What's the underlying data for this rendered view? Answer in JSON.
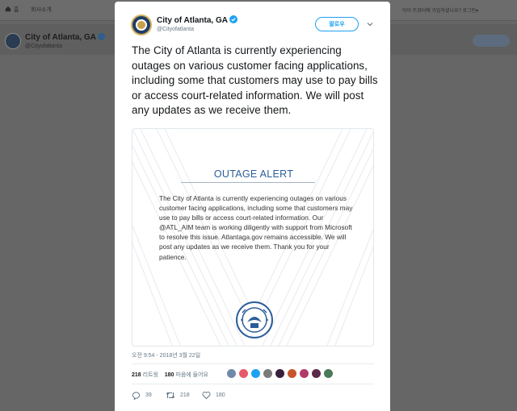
{
  "background": {
    "nav_home": "홈",
    "nav_about": "회사소개",
    "login_prompt": "아이 트위터에 가입하셨나요? 로그인▾",
    "profile_name": "City of Atlanta, GA",
    "profile_handle": "@Cityofatlanta"
  },
  "tweet": {
    "author_name": "City of Atlanta, GA",
    "author_handle": "@Cityofatlanta",
    "follow_label": "팔로우",
    "text": "The City of Atlanta is currently experiencing outages on various customer facing applications, including some that customers may use to pay bills or access court-related information. We will post any updates as we receive them.",
    "timestamp": "오전 9:54 - 2018년 3월 22일",
    "retweets_count": "218",
    "retweets_label": "리트윗",
    "likes_count": "180",
    "likes_label": "마음에 들어요",
    "replies": "39",
    "retweets_action": "218",
    "likes_action": "180"
  },
  "media": {
    "title": "OUTAGE ALERT",
    "body": "The City of Atlanta is currently experiencing outages on various customer facing applications, including some that customers may use to pay bills or access court-related information. Our @ATL_AIM team is working diligently with support from Microsoft to resolve this issue. Atlantaga.gov remains accessible. We will post any updates as we receive them. Thank you for your patience."
  },
  "colors": {
    "accent": "#1da1f2",
    "alert_blue": "#2b5d9a",
    "liker_colors": [
      "#6e8aa8",
      "#e85a6b",
      "#1da1f2",
      "#7a7a7a",
      "#3a1f3a",
      "#c7542d",
      "#b03a6a",
      "#5a2a4a",
      "#4a7a5a"
    ]
  }
}
